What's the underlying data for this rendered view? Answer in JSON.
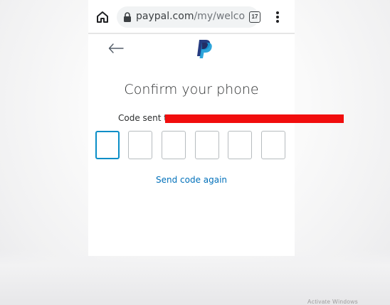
{
  "browser": {
    "url_host": "paypal.com",
    "url_path": "/my/welco",
    "tab_count": "17"
  },
  "page": {
    "title": "Confirm your phone",
    "code_sent_text": "Code sent to",
    "send_again_label": "Send code again"
  },
  "otp": {
    "digits": [
      "",
      "",
      "",
      "",
      "",
      ""
    ],
    "active_index": 0
  },
  "colors": {
    "link": "#0070ba",
    "active_border": "#0a8ec7",
    "redaction": "#f10d0d",
    "paypal_dark": "#253b80",
    "paypal_light": "#179bd7"
  },
  "watermark": "Activate Windows"
}
